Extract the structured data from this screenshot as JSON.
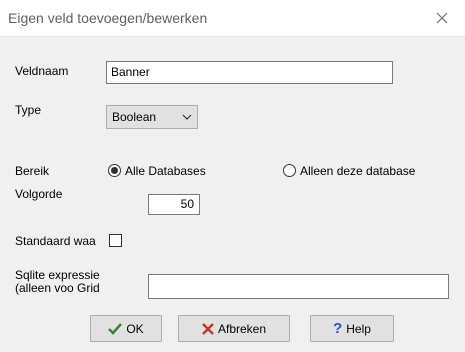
{
  "window": {
    "title": "Eigen veld toevoegen/bewerken"
  },
  "fields": {
    "veldnaam": {
      "label": "Veldnaam",
      "value": "Banner"
    },
    "type": {
      "label": "Type",
      "value": "Boolean"
    },
    "bereik": {
      "label": "Bereik",
      "option_all": "Alle Databases",
      "option_this": "Alleen deze database",
      "selected": "Alle Databases"
    },
    "volgorde": {
      "label": "Volgorde",
      "value": "50"
    },
    "standaard": {
      "label": "Standaard waa",
      "checked": false
    },
    "sqlite": {
      "label_line1": "Sqlite expressie",
      "label_line2": "(alleen voo Grid",
      "value": ""
    }
  },
  "buttons": {
    "ok": "OK",
    "cancel": "Afbreken",
    "help": "Help"
  },
  "colors": {
    "ok_check": "#2e8b2e",
    "cancel_x": "#c0392b",
    "help_q": "#1f57c3"
  }
}
